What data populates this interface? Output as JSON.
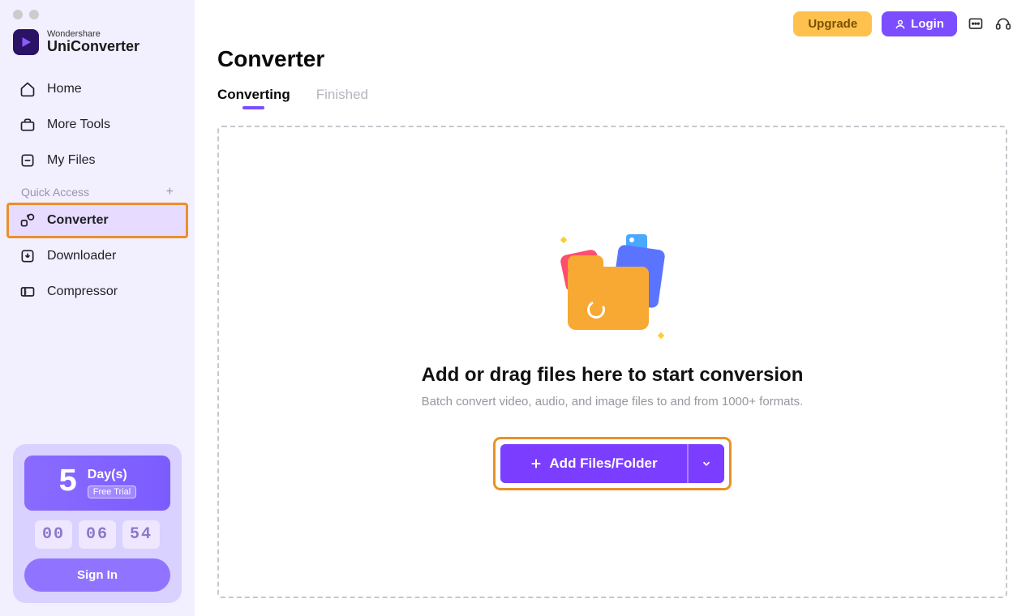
{
  "brand": {
    "top": "Wondershare",
    "bottom": "UniConverter"
  },
  "sidebar": {
    "items": [
      {
        "label": "Home"
      },
      {
        "label": "More Tools"
      },
      {
        "label": "My Files"
      }
    ],
    "quick_access_label": "Quick Access",
    "quick_items": [
      {
        "label": "Converter"
      },
      {
        "label": "Downloader"
      },
      {
        "label": "Compressor"
      }
    ]
  },
  "trial": {
    "digit": "5",
    "days_label": "Day(s)",
    "free_label": "Free Trial",
    "countdown": [
      "00",
      "06",
      "54"
    ],
    "signin_label": "Sign In"
  },
  "topbar": {
    "upgrade": "Upgrade",
    "login": "Login"
  },
  "page": {
    "title": "Converter",
    "tabs": [
      {
        "label": "Converting"
      },
      {
        "label": "Finished"
      }
    ]
  },
  "dropzone": {
    "title": "Add or drag files here to start conversion",
    "subtitle": "Batch convert video, audio, and image files to and from 1000+ formats.",
    "button": "Add Files/Folder"
  }
}
